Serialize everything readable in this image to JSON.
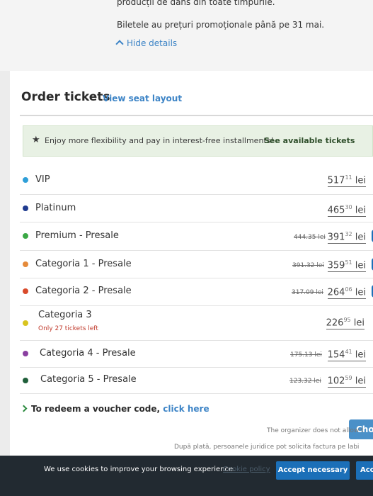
{
  "event_details": {
    "line1": "producții de dans din toate timpurile.",
    "line2": "Biletele au prețuri promoționale până pe 31 mai.",
    "hide_details_label": "Hide details"
  },
  "order": {
    "title": "Order tickets",
    "seat_layout_link": "View seat layout"
  },
  "promo": {
    "icon": "star-icon",
    "text": "Enjoy more flexibility and pay in interest-free installments!",
    "link": "See available tickets"
  },
  "tickets": [
    {
      "name": "VIP",
      "dot_color": "#2f9fd8",
      "old_price": "",
      "price_int": "517",
      "price_dec": "11",
      "currency": "lei"
    },
    {
      "name": "Platinum",
      "dot_color": "#1f3b8f",
      "old_price": "",
      "price_int": "465",
      "price_dec": "30",
      "currency": "lei"
    },
    {
      "name": "Premium - Presale",
      "dot_color": "#3aa845",
      "old_price": "444.35 lei",
      "price_int": "391",
      "price_dec": "32",
      "currency": "lei"
    },
    {
      "name": "Categoria 1 - Presale",
      "dot_color": "#e58a3a",
      "old_price": "391.32 lei",
      "price_int": "359",
      "price_dec": "51",
      "currency": "lei"
    },
    {
      "name": "Categoria 2 - Presale",
      "dot_color": "#d94a2b",
      "old_price": "317.09 lei",
      "price_int": "264",
      "price_dec": "06",
      "currency": "lei"
    },
    {
      "name": "Categoria 3",
      "note": "Only 27 tickets left",
      "dot_color": "#d8c41f",
      "old_price": "",
      "price_int": "226",
      "price_dec": "95",
      "currency": "lei"
    },
    {
      "name": "Categoria 4 - Presale",
      "dot_color": "#8a3fa0",
      "old_price": "175.13 lei",
      "price_int": "154",
      "price_dec": "41",
      "currency": "lei"
    },
    {
      "name": "Categoria 5 - Presale",
      "dot_color": "#1f5f3a",
      "old_price": "123.32 lei",
      "price_int": "102",
      "price_dec": "59",
      "currency": "lei"
    }
  ],
  "voucher": {
    "text": "To redeem a voucher code,",
    "link": "click here"
  },
  "choose_button": "Cho",
  "notes": {
    "organizer": "The organizer does not allow t",
    "invoice": "După plată, persoanele juridice pot solicita factura pe labi"
  },
  "cookie": {
    "text": "We use cookies to improve your browsing experience.",
    "policy_link": "Cookie policy",
    "accept_necessary": "Accept necessary",
    "accept_all": "Acc"
  }
}
